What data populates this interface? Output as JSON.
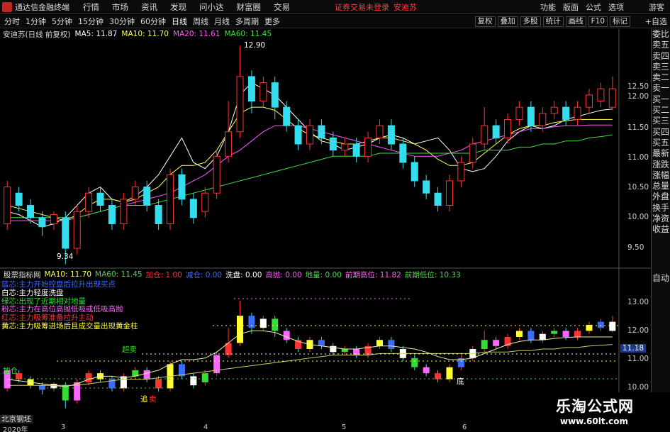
{
  "menubar": {
    "app_title": "通达信金融终端",
    "items": [
      "行情",
      "市场",
      "资讯",
      "发现",
      "问小达",
      "财富圈",
      "交易"
    ],
    "status_text": "证券交易未登录",
    "stock_name_top": "安迪苏",
    "right_items": [
      "功能",
      "版面",
      "公式",
      "选项"
    ],
    "guest": "游客"
  },
  "toolbar": {
    "timeframes": [
      "分时",
      "1分钟",
      "5分钟",
      "15分钟",
      "30分钟",
      "60分钟",
      "日线",
      "周线",
      "月线",
      "多周期",
      "更多"
    ],
    "active_timeframe": "日线",
    "right_buttons": [
      "复权",
      "叠加",
      "多股",
      "统计",
      "画线",
      "F10",
      "标记"
    ],
    "zixuan": "+自选"
  },
  "main_header": {
    "stock": "安迪苏(日线 前复权)",
    "ma5": "MA5: 11.87",
    "ma10": "MA10: 11.70",
    "ma20": "MA20: 11.61",
    "ma60": "MA60: 11.45"
  },
  "indicator_header": {
    "name": "股票指标网",
    "ma10": "MA10: 11.70",
    "ma60": "MA60: 11.45",
    "zhuli": "加仓: 1.00",
    "jianceng": "减仓: 0.00",
    "xipan": "洗盘: 0.00",
    "gaopao": "高抛: 0.00",
    "diliang": "地量: 0.00",
    "qianqi_high": "前期高位: 11.82",
    "qianqi_low": "前期低位: 10.33"
  },
  "legend": [
    {
      "text": "蓝芯:主力开始控盘后拉升出现买点",
      "color": "#3c6cff"
    },
    {
      "text": "白芯:主力轻度洗盘",
      "color": "#ffffff"
    },
    {
      "text": "绿芯:出现了近期相对地量",
      "color": "#33dd33"
    },
    {
      "text": "粉芯:主力在高位高抛低吸或低吸高抛",
      "color": "#ff66ff"
    },
    {
      "text": "红芯:主力吸筹准备拉升主动",
      "color": "#ff3333"
    },
    {
      "text": "黄芯:主力吸筹进场后且成交量出现黄金柱",
      "color": "#ffff33"
    }
  ],
  "price_axis": [
    "12.90",
    "12.50",
    "12.00",
    "11.50",
    "11.00",
    "10.50",
    "10.00",
    "9.50"
  ],
  "indicator_axis": [
    "13.00",
    "12.00",
    "11.18",
    "11.00",
    "10.00"
  ],
  "current_price_tag": "11.18",
  "annotations": {
    "high_label": "12.90",
    "low_label": "9.34",
    "chao_mai": "超卖",
    "jia_cang": "加仓",
    "zhui": "追",
    "mai": "卖",
    "di": "底"
  },
  "right_panel": [
    "委比",
    "卖五",
    "卖四",
    "卖三",
    "卖二",
    "卖一",
    "买一",
    "买二",
    "买三",
    "买四",
    "买五",
    "最新",
    "涨跌",
    "涨幅",
    "总量",
    "外盘",
    "换手",
    "净资",
    "收益"
  ],
  "right_panel_bottom": "自动",
  "bottom_info": "北京钢坯",
  "date_labels": [
    "2020年",
    "3",
    "4",
    "5",
    "6"
  ],
  "watermark": {
    "line1": "乐淘公式网",
    "line2": "www.60lt.com"
  },
  "colors": {
    "up": "#ff3333",
    "down": "#33ddee",
    "ma5": "#ffffff",
    "ma10": "#ffff55",
    "ma20": "#ff55ff",
    "ma60": "#44dd44"
  },
  "chart_data": {
    "type": "candlestick",
    "ylim": [
      9.3,
      13.0
    ],
    "series": [
      {
        "name": "MA5",
        "values": [
          10.2,
          10.15,
          10.05,
          9.95,
          10.0,
          10.1,
          10.3,
          10.5,
          10.6,
          10.4,
          10.35,
          10.45,
          10.6,
          10.8,
          11.1,
          11.4,
          11.0,
          10.9,
          11.1,
          11.5,
          12.1,
          12.3,
          12.2,
          12.1,
          11.9,
          11.7,
          11.5,
          11.35,
          11.3,
          11.2,
          11.25,
          11.3,
          11.4,
          11.45,
          11.4,
          11.3,
          11.35,
          11.4,
          11.2,
          10.9,
          10.85,
          10.9,
          11.1,
          11.35,
          11.5,
          11.6,
          11.55,
          11.6,
          11.7,
          11.75,
          11.8,
          11.85,
          11.87
        ]
      },
      {
        "name": "MA10",
        "values": [
          10.3,
          10.25,
          10.2,
          10.15,
          10.1,
          10.05,
          10.15,
          10.3,
          10.4,
          10.4,
          10.35,
          10.4,
          10.5,
          10.6,
          10.8,
          10.95,
          10.95,
          11.0,
          11.2,
          11.5,
          11.8,
          11.9,
          11.9,
          11.85,
          11.7,
          11.55,
          11.45,
          11.4,
          11.35,
          11.3,
          11.3,
          11.35,
          11.4,
          11.4,
          11.35,
          11.3,
          11.2,
          11.05,
          10.95,
          10.95,
          11.0,
          11.15,
          11.3,
          11.45,
          11.55,
          11.6,
          11.6,
          11.65,
          11.68,
          11.7,
          11.7,
          11.7,
          11.7
        ]
      },
      {
        "name": "MA20",
        "values": [
          10.05,
          10.05,
          10.05,
          10.05,
          10.05,
          10.05,
          10.1,
          10.15,
          10.2,
          10.25,
          10.3,
          10.35,
          10.4,
          10.45,
          10.5,
          10.6,
          10.7,
          10.8,
          10.95,
          11.1,
          11.2,
          11.35,
          11.5,
          11.6,
          11.6,
          11.6,
          11.55,
          11.5,
          11.45,
          11.4,
          11.35,
          11.3,
          11.25,
          11.2,
          11.15,
          11.1,
          11.1,
          11.1,
          11.15,
          11.2,
          11.3,
          11.35,
          11.4,
          11.45,
          11.5,
          11.55,
          11.55,
          11.58,
          11.6,
          11.6,
          11.61,
          11.61,
          11.61
        ]
      },
      {
        "name": "MA60",
        "values": [
          10.1,
          10.1,
          10.1,
          10.1,
          10.1,
          10.1,
          10.1,
          10.15,
          10.2,
          10.25,
          10.3,
          10.3,
          10.3,
          10.35,
          10.4,
          10.45,
          10.5,
          10.55,
          10.6,
          10.65,
          10.7,
          10.75,
          10.8,
          10.85,
          10.9,
          10.95,
          11.0,
          11.05,
          11.1,
          11.1,
          11.1,
          11.1,
          11.15,
          11.15,
          11.15,
          11.15,
          11.15,
          11.15,
          11.15,
          11.15,
          11.15,
          11.2,
          11.2,
          11.2,
          11.25,
          11.25,
          11.3,
          11.3,
          11.35,
          11.35,
          11.4,
          11.42,
          11.45
        ]
      }
    ],
    "candles": [
      [
        10.0,
        10.6,
        10.7,
        9.9
      ],
      [
        10.5,
        10.3,
        10.6,
        10.2
      ],
      [
        10.3,
        10.1,
        10.4,
        10.0
      ],
      [
        10.1,
        9.95,
        10.2,
        9.8
      ],
      [
        10.0,
        10.15,
        10.2,
        9.9
      ],
      [
        10.1,
        9.6,
        10.2,
        9.34
      ],
      [
        9.6,
        10.2,
        10.3,
        9.5
      ],
      [
        10.2,
        10.5,
        10.6,
        10.1
      ],
      [
        10.5,
        10.3,
        10.6,
        10.2
      ],
      [
        10.3,
        10.0,
        10.4,
        9.9
      ],
      [
        10.0,
        10.4,
        10.5,
        9.9
      ],
      [
        10.4,
        10.6,
        10.7,
        10.3
      ],
      [
        10.6,
        10.3,
        10.7,
        10.2
      ],
      [
        10.3,
        10.0,
        10.4,
        9.9
      ],
      [
        10.0,
        10.8,
        10.9,
        9.9
      ],
      [
        10.8,
        10.4,
        10.9,
        10.3
      ],
      [
        10.4,
        10.1,
        10.5,
        10.0
      ],
      [
        10.2,
        10.5,
        10.6,
        10.1
      ],
      [
        10.5,
        11.1,
        11.2,
        10.4
      ],
      [
        11.1,
        11.5,
        12.0,
        11.0
      ],
      [
        11.5,
        12.4,
        12.9,
        11.4
      ],
      [
        12.4,
        12.0,
        12.5,
        11.8
      ],
      [
        12.0,
        12.3,
        12.4,
        11.9
      ],
      [
        12.3,
        11.9,
        12.4,
        11.7
      ],
      [
        11.9,
        11.6,
        12.0,
        11.5
      ],
      [
        11.6,
        11.3,
        11.7,
        11.2
      ],
      [
        11.3,
        11.6,
        11.7,
        11.2
      ],
      [
        11.6,
        11.4,
        11.7,
        11.3
      ],
      [
        11.4,
        11.2,
        11.5,
        11.1
      ],
      [
        11.2,
        11.3,
        11.4,
        11.1
      ],
      [
        11.3,
        11.1,
        11.4,
        11.0
      ],
      [
        11.1,
        11.4,
        11.5,
        11.0
      ],
      [
        11.4,
        11.6,
        11.7,
        11.3
      ],
      [
        11.6,
        11.3,
        11.7,
        11.2
      ],
      [
        11.3,
        11.0,
        11.4,
        10.9
      ],
      [
        11.0,
        10.7,
        11.1,
        10.6
      ],
      [
        10.7,
        10.5,
        10.8,
        10.4
      ],
      [
        10.5,
        10.3,
        10.6,
        10.2
      ],
      [
        10.3,
        10.7,
        10.8,
        10.2
      ],
      [
        10.7,
        11.0,
        11.1,
        10.6
      ],
      [
        11.0,
        11.3,
        11.4,
        10.9
      ],
      [
        11.3,
        11.6,
        11.9,
        11.2
      ],
      [
        11.6,
        11.4,
        11.7,
        11.3
      ],
      [
        11.4,
        11.7,
        11.8,
        11.3
      ],
      [
        11.7,
        11.9,
        12.0,
        11.6
      ],
      [
        11.9,
        11.6,
        12.0,
        11.5
      ],
      [
        11.6,
        11.8,
        11.9,
        11.5
      ],
      [
        11.8,
        11.9,
        12.0,
        11.7
      ],
      [
        11.9,
        11.7,
        12.0,
        11.6
      ],
      [
        11.7,
        11.9,
        12.0,
        11.6
      ],
      [
        11.9,
        12.1,
        12.2,
        11.8
      ],
      [
        12.0,
        12.2,
        12.3,
        11.9
      ],
      [
        11.9,
        12.2,
        12.4,
        11.85
      ]
    ]
  }
}
